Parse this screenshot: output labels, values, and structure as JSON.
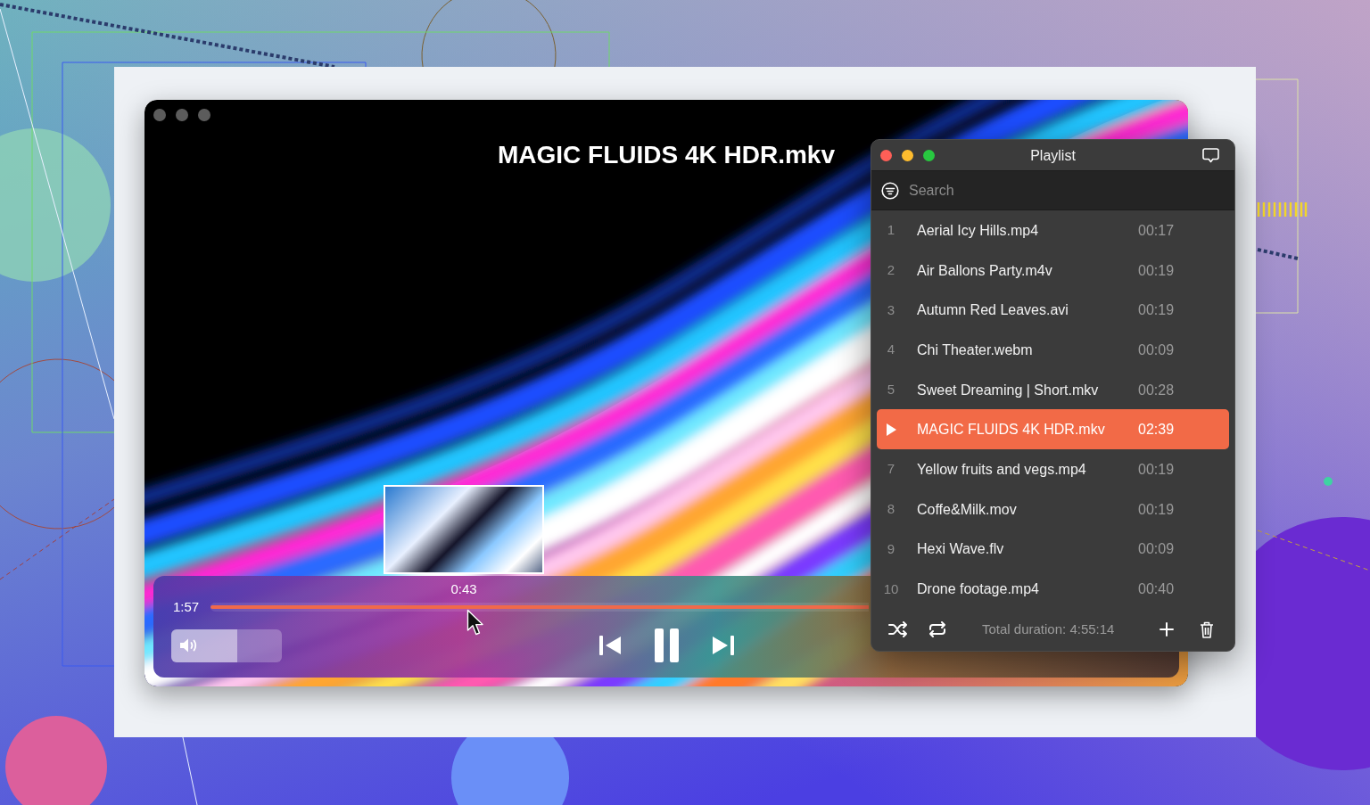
{
  "player": {
    "title": "MAGIC FLUIDS 4K HDR.mkv",
    "preview_time": "0:43",
    "elapsed": "1:57",
    "progress": {
      "level": 1
    },
    "volume": {
      "level": 0.6
    },
    "playing": true
  },
  "playlist": {
    "title": "Playlist",
    "search": {
      "placeholder": "Search"
    },
    "items": [
      {
        "number": "1",
        "name": "Aerial Icy Hills.mp4",
        "duration": "00:17",
        "selected": false
      },
      {
        "number": "2",
        "name": "Air Ballons Party.m4v",
        "duration": "00:19",
        "selected": false
      },
      {
        "number": "3",
        "name": "Autumn Red Leaves.avi",
        "duration": "00:19",
        "selected": false
      },
      {
        "number": "4",
        "name": "Chi Theater.webm",
        "duration": "00:09",
        "selected": false
      },
      {
        "number": "5",
        "name": "Sweet Dreaming | Short.mkv",
        "duration": "00:28",
        "selected": false
      },
      {
        "name": "MAGIC FLUIDS 4K HDR.mkv",
        "duration": "02:39",
        "selected": true
      },
      {
        "number": "7",
        "name": "Yellow fruits and vegs.mp4",
        "duration": "00:19",
        "selected": false
      },
      {
        "number": "8",
        "name": "Coffe&Milk.mov",
        "duration": "00:19",
        "selected": false
      },
      {
        "number": "9",
        "name": "Hexi Wave.flv",
        "duration": "00:09",
        "selected": false
      },
      {
        "number": "10",
        "name": "Drone footage.mp4",
        "duration": "00:40",
        "selected": false
      }
    ],
    "total_duration": "Total duration: 4:55:14"
  }
}
